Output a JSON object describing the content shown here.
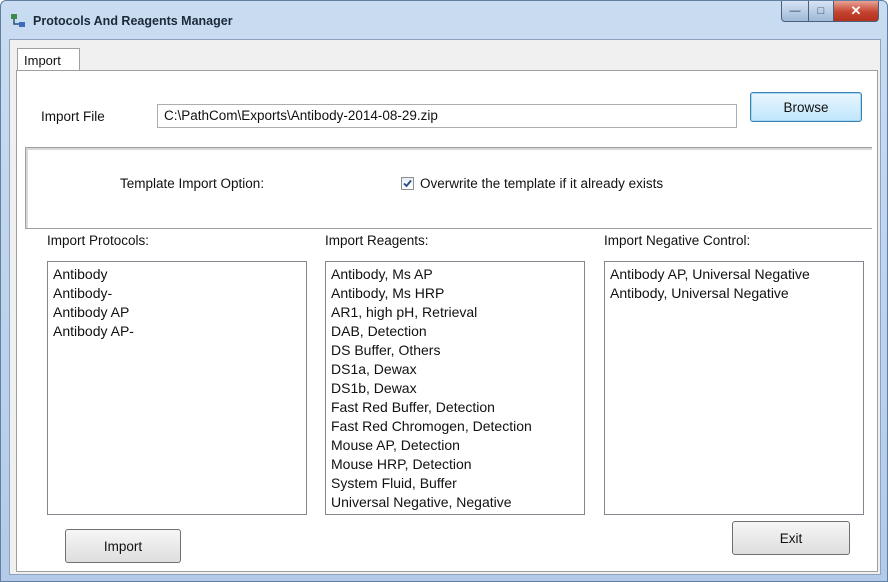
{
  "window": {
    "title": "Protocols And Reagents Manager"
  },
  "tabs": [
    {
      "label": "Import"
    }
  ],
  "import_file": {
    "label": "Import File",
    "value": "C:\\PathCom\\Exports\\Antibody-2014-08-29.zip",
    "browse_label": "Browse"
  },
  "template_option": {
    "label": "Template Import Option:",
    "checkbox_label": "Overwrite the template if it already exists",
    "checked": true
  },
  "protocols": {
    "label": "Import Protocols:",
    "items": [
      "Antibody",
      "Antibody-",
      "Antibody AP",
      "Antibody AP-"
    ]
  },
  "reagents": {
    "label": "Import Reagents:",
    "items": [
      "Antibody, Ms AP",
      "Antibody, Ms HRP",
      "AR1, high pH, Retrieval",
      "DAB, Detection",
      "DS Buffer, Others",
      "DS1a, Dewax",
      "DS1b, Dewax",
      "Fast Red Buffer, Detection",
      "Fast Red Chromogen, Detection",
      "Mouse AP, Detection",
      "Mouse HRP, Detection",
      "System Fluid, Buffer",
      "Universal Negative, Negative"
    ]
  },
  "negative_control": {
    "label": "Import Negative Control:",
    "items": [
      "Antibody AP, Universal Negative",
      "Antibody, Universal Negative"
    ]
  },
  "actions": {
    "import_label": "Import",
    "exit_label": "Exit"
  }
}
